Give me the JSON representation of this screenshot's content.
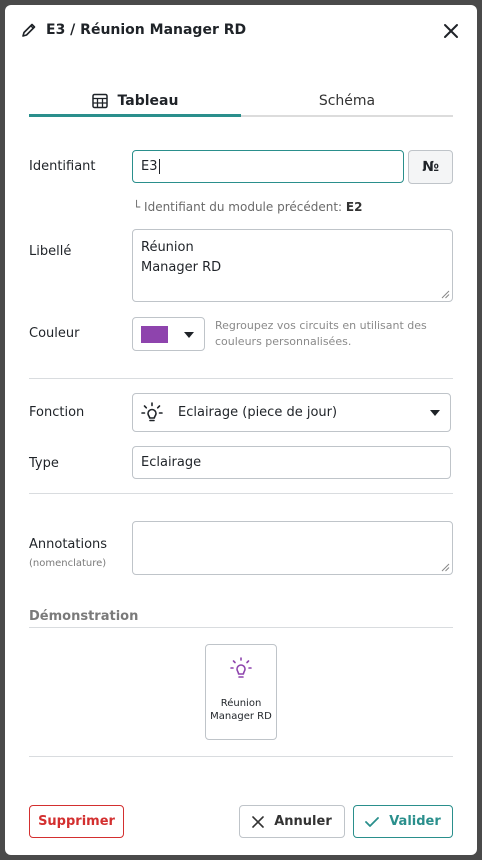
{
  "header": {
    "title": "E3  / Réunion Manager RD",
    "edit_icon": "pencil-icon",
    "close_icon": "close-icon"
  },
  "tabs": [
    {
      "label": "Tableau",
      "icon": "table-icon",
      "active": true
    },
    {
      "label": "Schéma",
      "active": false
    }
  ],
  "form": {
    "identifiant": {
      "label": "Identifiant",
      "value": "E3",
      "num_button": "№"
    },
    "hint": {
      "prefix": "└ Identifiant du module précédent: ",
      "value": "E2"
    },
    "libelle": {
      "label": "Libellé",
      "line1": "Réunion",
      "line2": "Manager RD"
    },
    "couleur": {
      "label": "Couleur",
      "value": "#8e44ad",
      "help": "Regroupez vos circuits en utilisant des couleurs personnalisées."
    },
    "fonction": {
      "label": "Fonction",
      "value": "Eclairage (piece de jour)",
      "icon": "lightbulb-icon"
    },
    "type": {
      "label": "Type",
      "value": "Eclairage"
    },
    "annotations": {
      "label": "Annotations",
      "sublabel": "(nomenclature)",
      "value": ""
    }
  },
  "demo": {
    "title": "Démonstration",
    "card_label": "Réunion Manager RD",
    "icon": "lightbulb-icon",
    "icon_color": "#8e44ad"
  },
  "footer": {
    "delete_label": "Supprimer",
    "cancel_label": "Annuler",
    "validate_label": "Valider"
  },
  "colors": {
    "accent": "#2a8f8c",
    "danger": "#d32f2f"
  }
}
